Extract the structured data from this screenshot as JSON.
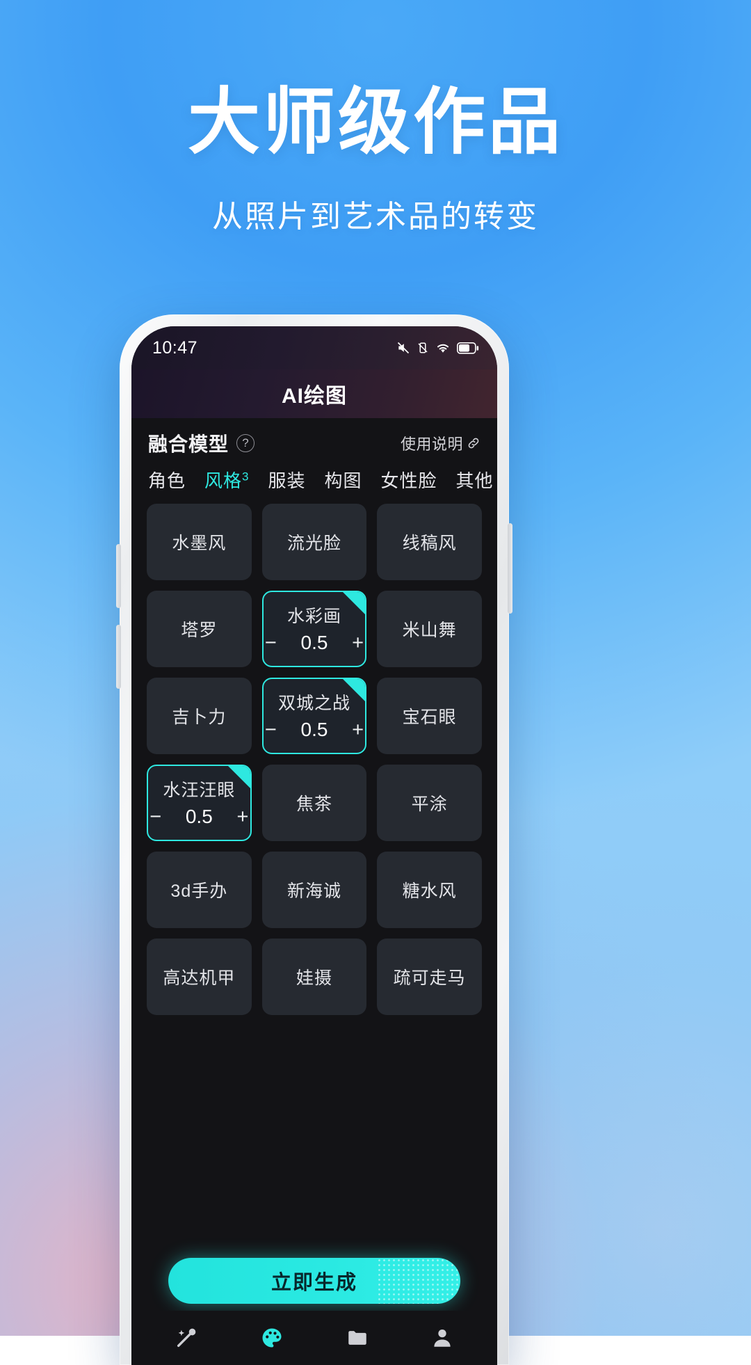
{
  "promo": {
    "headline": "大师级作品",
    "subhead": "从照片到艺术品的转变"
  },
  "status_bar": {
    "time": "10:47",
    "icons": [
      "mute-icon",
      "vibrate-icon",
      "wifi-icon",
      "battery-icon"
    ]
  },
  "app": {
    "title": "AI绘图",
    "model_section": {
      "title": "融合模型",
      "help_badge": "?",
      "usage_link": "使用说明",
      "link_icon": "link-icon"
    },
    "tabs": [
      {
        "label": "角色",
        "sup": "",
        "active": false
      },
      {
        "label": "风格",
        "sup": "3",
        "active": true
      },
      {
        "label": "服装",
        "sup": "",
        "active": false
      },
      {
        "label": "构图",
        "sup": "",
        "active": false
      },
      {
        "label": "女性脸",
        "sup": "",
        "active": false
      },
      {
        "label": "其他",
        "sup": "",
        "active": false
      }
    ],
    "cards": [
      {
        "label": "水墨风",
        "selected": false,
        "value": ""
      },
      {
        "label": "流光脸",
        "selected": false,
        "value": ""
      },
      {
        "label": "线稿风",
        "selected": false,
        "value": ""
      },
      {
        "label": "塔罗",
        "selected": false,
        "value": ""
      },
      {
        "label": "水彩画",
        "selected": true,
        "value": "0.5"
      },
      {
        "label": "米山舞",
        "selected": false,
        "value": ""
      },
      {
        "label": "吉卜力",
        "selected": false,
        "value": ""
      },
      {
        "label": "双城之战",
        "selected": true,
        "value": "0.5"
      },
      {
        "label": "宝石眼",
        "selected": false,
        "value": ""
      },
      {
        "label": "水汪汪眼",
        "selected": true,
        "value": "0.5"
      },
      {
        "label": "焦茶",
        "selected": false,
        "value": ""
      },
      {
        "label": "平涂",
        "selected": false,
        "value": ""
      },
      {
        "label": "3d手办",
        "selected": false,
        "value": ""
      },
      {
        "label": "新海诚",
        "selected": false,
        "value": ""
      },
      {
        "label": "糖水风",
        "selected": false,
        "value": ""
      },
      {
        "label": "高达机甲",
        "selected": false,
        "value": ""
      },
      {
        "label": "娃摄",
        "selected": false,
        "value": ""
      },
      {
        "label": "疏可走马",
        "selected": false,
        "value": ""
      }
    ],
    "stepper": {
      "minus": "−",
      "plus": "+"
    },
    "cta": {
      "label": "立即生成"
    },
    "bottom_nav": [
      {
        "icon": "magic-wand-icon",
        "active": false
      },
      {
        "icon": "palette-icon",
        "active": true
      },
      {
        "icon": "folder-icon",
        "active": false
      },
      {
        "icon": "person-icon",
        "active": false
      }
    ]
  },
  "colors": {
    "accent": "#2ee8e0",
    "app_bg": "#131316",
    "card_bg": "#262a31",
    "brand_blue": "#4aa7f6"
  }
}
